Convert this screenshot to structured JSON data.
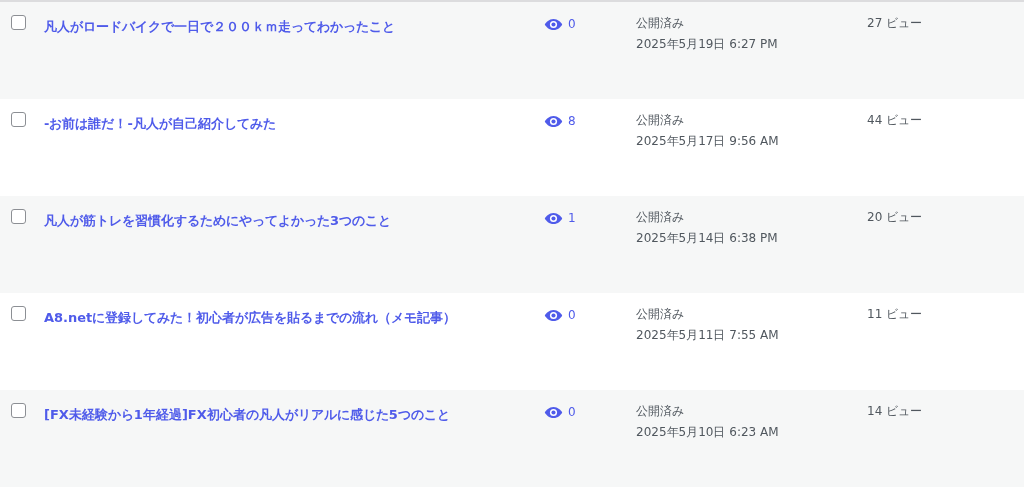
{
  "rows": [
    {
      "checked": false,
      "title": "凡人がロードバイクで一日で２００ｋｍ走ってわかったこと",
      "comments": "0",
      "status": "公開済み",
      "date": "2025年5月19日 6:27 PM",
      "views": "27 ビュー"
    },
    {
      "checked": false,
      "title": "-お前は誰だ！-凡人が自己紹介してみた",
      "comments": "8",
      "status": "公開済み",
      "date": "2025年5月17日 9:56 AM",
      "views": "44 ビュー"
    },
    {
      "checked": false,
      "title": "凡人が筋トレを習慣化するためにやってよかった3つのこと",
      "comments": "1",
      "status": "公開済み",
      "date": "2025年5月14日 6:38 PM",
      "views": "20 ビュー"
    },
    {
      "checked": false,
      "title": "A8.netに登録してみた！初心者が広告を貼るまでの流れ（メモ記事）",
      "comments": "0",
      "status": "公開済み",
      "date": "2025年5月11日 7:55 AM",
      "views": "11 ビュー"
    },
    {
      "checked": false,
      "title": "[FX未経験から1年経過]FX初心者の凡人がリアルに感じた5つのこと",
      "comments": "0",
      "status": "公開済み",
      "date": "2025年5月10日 6:23 AM",
      "views": "14 ビュー"
    }
  ]
}
